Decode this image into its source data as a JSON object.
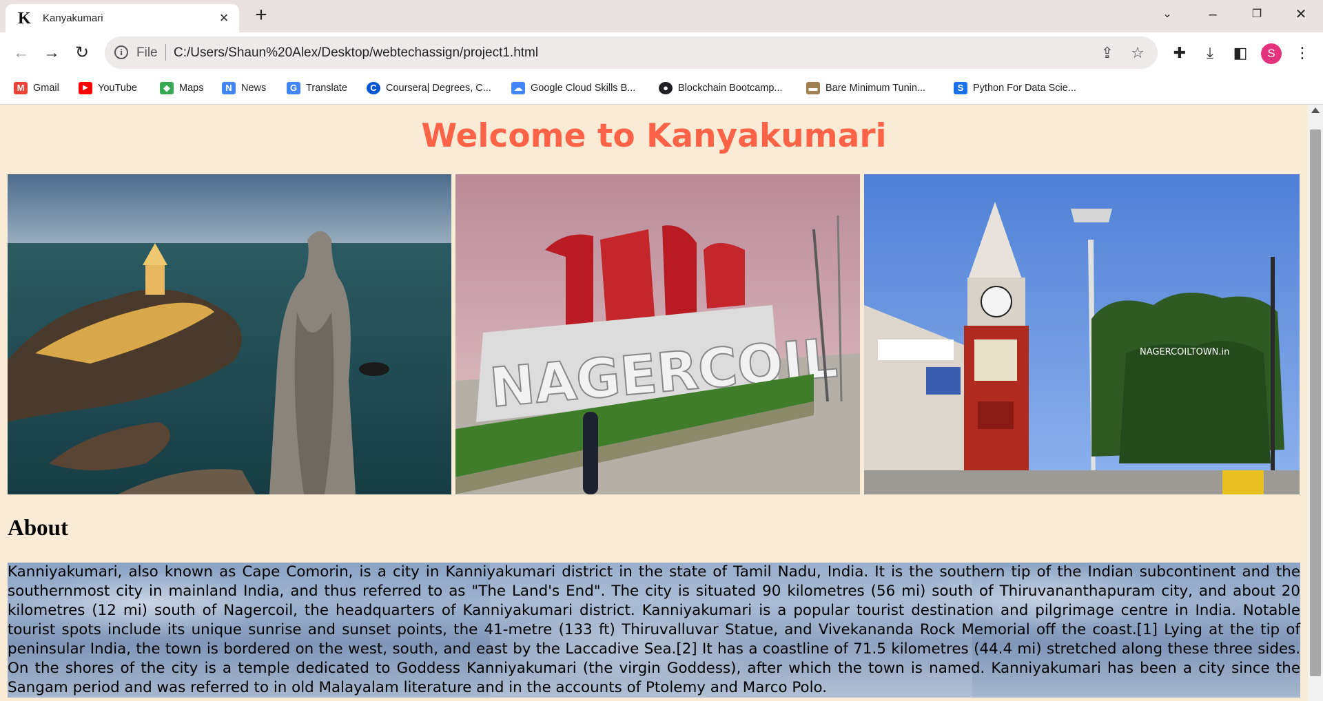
{
  "tab": {
    "title": "Kanyakumari",
    "favicon_letter": "K"
  },
  "toolbar": {
    "scheme": "File",
    "url": "C:/Users/Shaun%20Alex/Desktop/webtechassign/project1.html",
    "profile_initial": "S"
  },
  "bookmarks": [
    {
      "label": "Gmail",
      "icon": "gmail-icon",
      "color": "#ea4335",
      "glyph": "M"
    },
    {
      "label": "YouTube",
      "icon": "youtube-icon",
      "color": "#ff0000",
      "glyph": "▶"
    },
    {
      "label": "Maps",
      "icon": "maps-icon",
      "color": "#34a853",
      "glyph": "◆"
    },
    {
      "label": "News",
      "icon": "news-icon",
      "color": "#4285f4",
      "glyph": "N"
    },
    {
      "label": "Translate",
      "icon": "translate-icon",
      "color": "#4285f4",
      "glyph": "G"
    },
    {
      "label": "Coursera| Degrees, C...",
      "icon": "coursera-icon",
      "color": "#0056d2",
      "glyph": "C"
    },
    {
      "label": "Google Cloud Skills B...",
      "icon": "google-cloud-icon",
      "color": "#4285f4",
      "glyph": "☁"
    },
    {
      "label": "Blockchain Bootcamp...",
      "icon": "blockchain-icon",
      "color": "#202124",
      "glyph": "●"
    },
    {
      "label": "Bare Minimum Tunin...",
      "icon": "bare-minimum-icon",
      "color": "#a08050",
      "glyph": "▬"
    },
    {
      "label": "Python For Data Scie...",
      "icon": "python-course-icon",
      "color": "#1a73e8",
      "glyph": "S"
    }
  ],
  "page": {
    "title": "Welcome to Kanyakumari",
    "about_heading": "About",
    "about_text": "Kanniyakumari, also known as Cape Comorin, is a city in Kanniyakumari district in the state of Tamil Nadu, India. It is the southern tip of the Indian subcontinent and the southernmost city in mainland India, and thus referred to as \"The Land's End\". The city is situated 90 kilometres (56 mi) south of Thiruvananthapuram city, and about 20 kilometres (12 mi) south of Nagercoil, the headquarters of Kanniyakumari district. Kanniyakumari is a popular tourist destination and pilgrimage centre in India. Notable tourist spots include its unique sunrise and sunset points, the 41-metre (133 ft) Thiruvalluvar Statue, and Vivekananda Rock Memorial off the coast.[1] Lying at the tip of peninsular India, the town is bordered on the west, south, and east by the Laccadive Sea.[2] It has a coastline of 71.5 kilometres (44.4 mi) stretched along these three sides. On the shores of the city is a temple dedicated to Goddess Kanniyakumari (the virgin Goddess), after which the town is named. Kanniyakumari has been a city since the Sangam period and was referred to in old Malayalam literature and in the accounts of Ptolemy and Marco Polo.",
    "photo2_sign_text": "NAGERCOIL",
    "photo3_watermark": "NAGERCOILTOWN.in"
  },
  "colors": {
    "page_bg": "#faebd7",
    "title": "#ff6347"
  }
}
